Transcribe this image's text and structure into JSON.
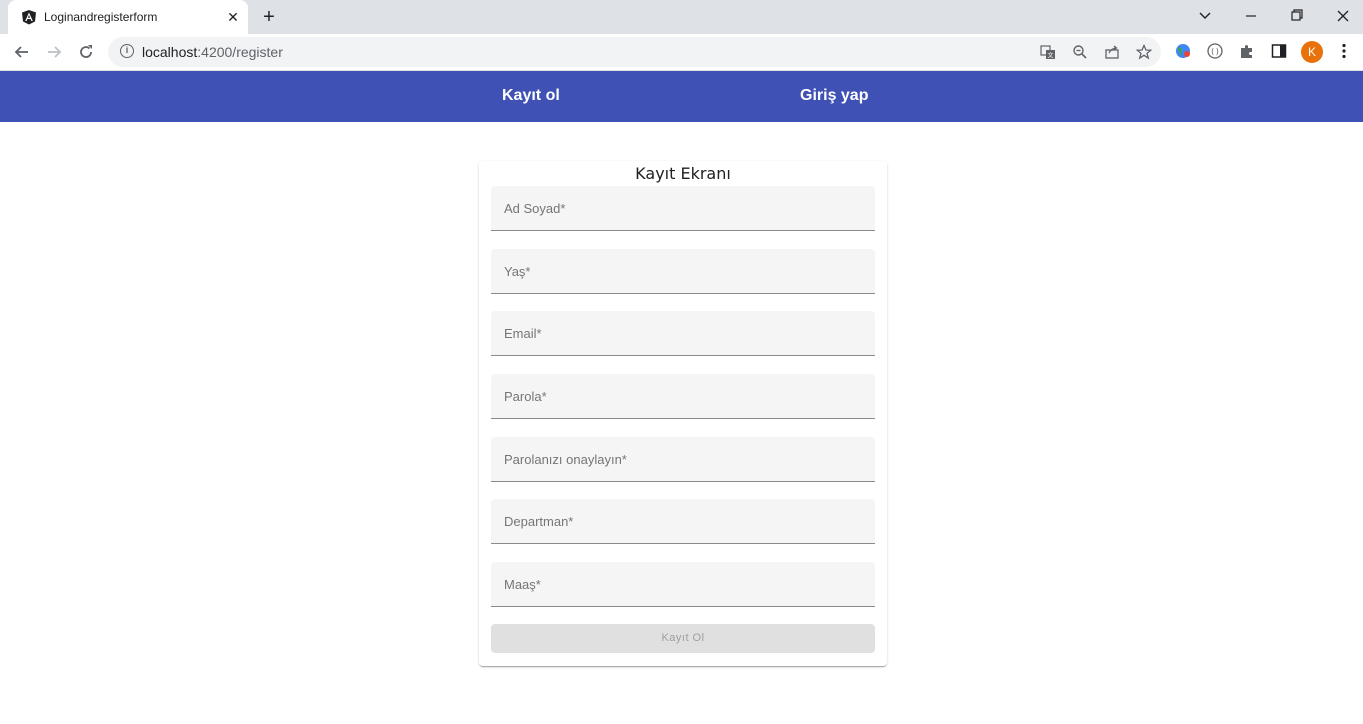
{
  "browser": {
    "tab_title": "Loginandregisterform",
    "tab_close_glyph": "✕",
    "new_tab_glyph": "+",
    "url_host": "localhost",
    "url_path": ":4200/register",
    "avatar_letter": "K",
    "icons": {
      "back": "back-arrow-icon",
      "forward": "forward-arrow-icon",
      "reload": "reload-icon",
      "translate": "translate-icon",
      "zoom": "zoom-out-icon",
      "share": "share-icon",
      "bookmark": "star-icon",
      "extensions": "puzzle-icon",
      "sidepanel": "side-panel-icon",
      "menu": "kebab-menu-icon"
    }
  },
  "nav": {
    "register_label": "Kayıt ol",
    "login_label": "Giriş yap"
  },
  "form": {
    "title": "Kayıt Ekranı",
    "fields": [
      {
        "label": "Ad Soyad*"
      },
      {
        "label": "Yaş*"
      },
      {
        "label": "Email*"
      },
      {
        "label": "Parola*"
      },
      {
        "label": "Parolanızı onaylayın*"
      },
      {
        "label": "Departman*"
      },
      {
        "label": "Maaş*"
      }
    ],
    "submit_label": "Kayıt Ol"
  },
  "colors": {
    "appbar": "#3f51b5",
    "field_bg": "#f5f5f5",
    "button_disabled": "#e0e0e0"
  }
}
